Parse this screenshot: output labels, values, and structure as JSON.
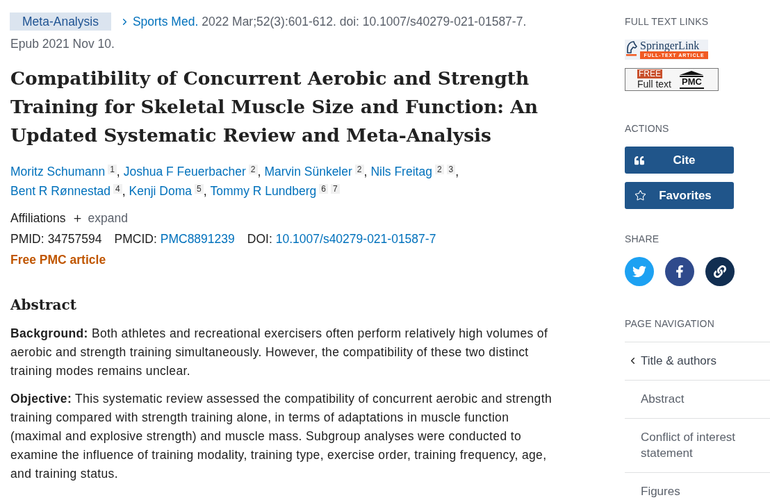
{
  "header": {
    "publication_type": "Meta-Analysis",
    "journal": "Sports Med.",
    "citation": "2022 Mar;52(3):601-612. doi: 10.1007/s40279-021-01587-7.",
    "epub": "Epub 2021 Nov 10."
  },
  "title": "Compatibility of Concurrent Aerobic and Strength Training for Skeletal Muscle Size and Function: An Updated Systematic Review and Meta-Analysis",
  "authors": [
    {
      "name": "Moritz Schumann",
      "affiliations": [
        "1"
      ],
      "separator": ","
    },
    {
      "name": "Joshua F Feuerbacher",
      "affiliations": [
        "2"
      ],
      "separator": ","
    },
    {
      "name": "Marvin Sünkeler",
      "affiliations": [
        "2"
      ],
      "separator": ","
    },
    {
      "name": "Nils Freitag",
      "affiliations": [
        "2",
        "3"
      ],
      "separator": ","
    },
    {
      "name": "Bent R Rønnestad",
      "affiliations": [
        "4"
      ],
      "separator": ","
    },
    {
      "name": "Kenji Doma",
      "affiliations": [
        "5"
      ],
      "separator": ","
    },
    {
      "name": "Tommy R Lundberg",
      "affiliations": [
        "6",
        "7"
      ]
    }
  ],
  "affiliations": {
    "label": "Affiliations",
    "toggle": "expand",
    "expanded": false
  },
  "identifiers": [
    {
      "label": "PMID:",
      "value": "34757594",
      "link": false
    },
    {
      "label": "PMCID:",
      "value": "PMC8891239",
      "link": true
    },
    {
      "label": "DOI:",
      "value": "10.1007/s40279-021-01587-7",
      "link": true
    }
  ],
  "free_pmc": "Free PMC article",
  "abstract": {
    "heading": "Abstract",
    "sections": [
      {
        "label": "Background:",
        "text": "Both athletes and recreational exercisers often perform relatively high volumes of aerobic and strength training simultaneously. However, the compatibility of these two distinct training modes remains unclear."
      },
      {
        "label": "Objective:",
        "text": "This systematic review assessed the compatibility of concurrent aerobic and strength training compared with strength training alone, in terms of adaptations in muscle function (maximal and explosive strength) and muscle mass. Subgroup analyses were conducted to examine the influence of training modality, training type, exercise order, training frequency, age, and training status."
      }
    ]
  },
  "sidebar": {
    "full_text_links": {
      "heading": "FULL TEXT LINKS",
      "links": [
        {
          "kind": "publisher",
          "name": "SpringerLink",
          "tagline": "FULL-TEXT ARTICLE"
        },
        {
          "kind": "pmc",
          "badge": "FREE",
          "label": "Full text",
          "logo": "PMC"
        }
      ]
    },
    "actions": {
      "heading": "ACTIONS",
      "buttons": [
        {
          "kind": "cite",
          "label": "Cite"
        },
        {
          "kind": "favorites",
          "label": "Favorites"
        }
      ]
    },
    "share": {
      "heading": "SHARE",
      "links": [
        {
          "kind": "twitter"
        },
        {
          "kind": "facebook"
        },
        {
          "kind": "permalink"
        }
      ]
    },
    "page_navigation": {
      "heading": "PAGE NAVIGATION",
      "items": [
        {
          "label": "Title & authors",
          "selected": true
        },
        {
          "label": "Abstract",
          "selected": false
        },
        {
          "label": "Conflict of interest statement",
          "selected": false
        },
        {
          "label": "Figures",
          "selected": false
        }
      ]
    }
  }
}
